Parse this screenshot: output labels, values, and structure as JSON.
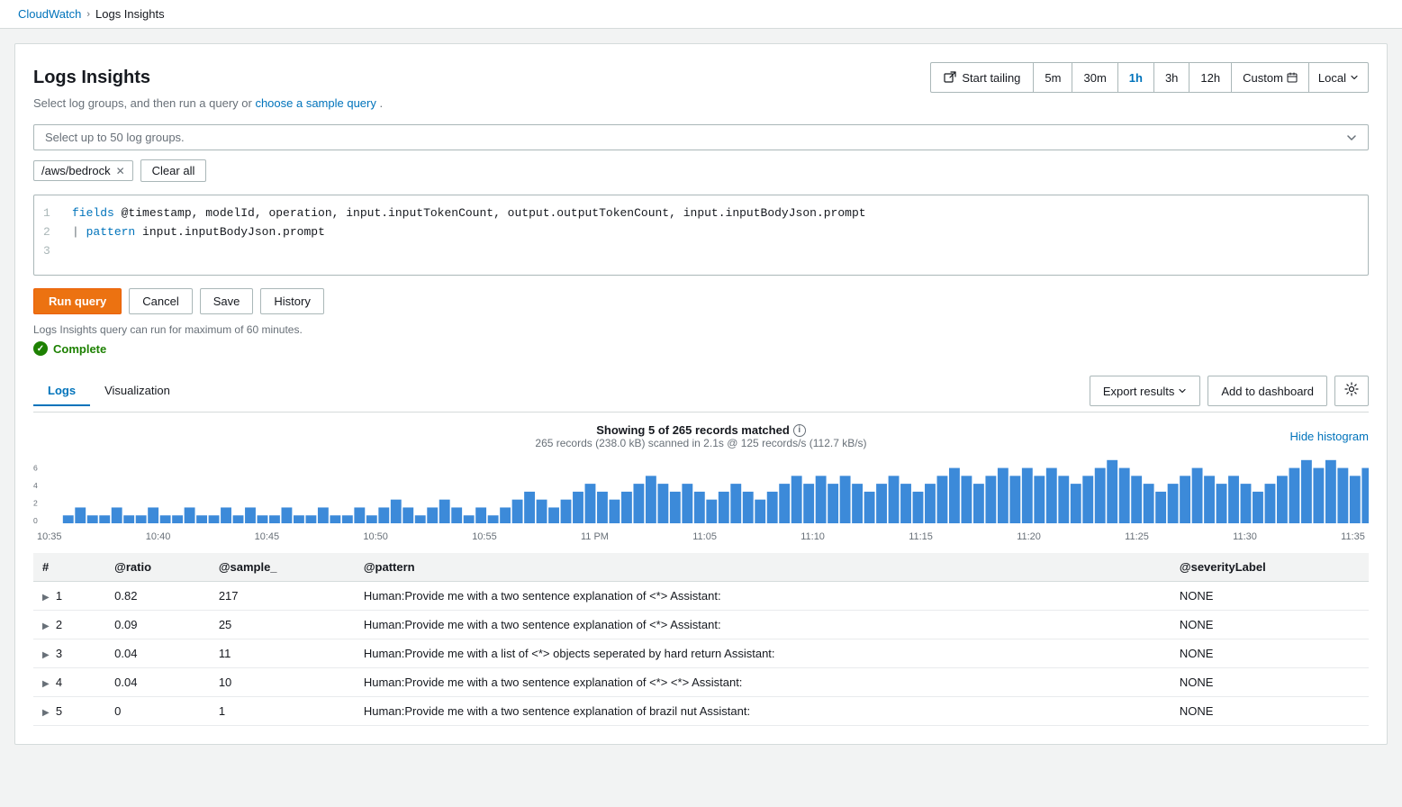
{
  "breadcrumb": {
    "parent": "CloudWatch",
    "separator": "›",
    "current": "Logs Insights"
  },
  "header": {
    "title": "Logs Insights",
    "subtitle_before": "Select log groups, and then run a query or",
    "subtitle_link": "choose a sample query",
    "subtitle_after": ".",
    "start_tailing_label": "Start tailing",
    "time_options": [
      "5m",
      "30m",
      "1h",
      "3h",
      "12h"
    ],
    "active_time": "1h",
    "custom_label": "Custom",
    "local_label": "Local"
  },
  "log_group_selector": {
    "placeholder": "Select up to 50 log groups.",
    "selected_tags": [
      {
        "name": "/aws/bedrock"
      }
    ],
    "clear_all_label": "Clear all"
  },
  "query_editor": {
    "lines": [
      {
        "num": "1",
        "content": "fields @timestamp, modelId, operation, input.inputTokenCount, output.outputTokenCount, input.inputBodyJson.prompt"
      },
      {
        "num": "2",
        "content": "| pattern input.inputBodyJson.prompt"
      },
      {
        "num": "3",
        "content": ""
      }
    ],
    "run_label": "Run query",
    "cancel_label": "Cancel",
    "save_label": "Save",
    "history_label": "History",
    "note": "Logs Insights query can run for maximum of 60 minutes.",
    "status": "Complete"
  },
  "tabs": [
    {
      "id": "logs",
      "label": "Logs",
      "active": true
    },
    {
      "id": "visualization",
      "label": "Visualization",
      "active": false
    }
  ],
  "results_controls": {
    "export_label": "Export results",
    "dashboard_label": "Add to dashboard"
  },
  "histogram": {
    "title": "Showing 5 of 265 records matched",
    "subtitle": "265 records (238.0 kB) scanned in 2.1s @ 125 records/s (112.7 kB/s)",
    "hide_label": "Hide histogram",
    "x_labels": [
      "10:35",
      "10:40",
      "10:45",
      "10:50",
      "10:55",
      "11 PM",
      "11:05",
      "11:10",
      "11:15",
      "11:20",
      "11:25",
      "11:30",
      "11:35"
    ],
    "bars": [
      0,
      1,
      2,
      1,
      1,
      2,
      1,
      1,
      2,
      1,
      1,
      2,
      1,
      1,
      2,
      1,
      2,
      1,
      1,
      2,
      1,
      1,
      2,
      1,
      1,
      2,
      1,
      2,
      3,
      2,
      1,
      2,
      3,
      2,
      1,
      2,
      1,
      2,
      3,
      4,
      3,
      2,
      3,
      4,
      5,
      4,
      3,
      4,
      5,
      6,
      5,
      4,
      5,
      4,
      3,
      4,
      5,
      4,
      3,
      4,
      5,
      6,
      5,
      6,
      5,
      6,
      5,
      4,
      5,
      6,
      5,
      4,
      5,
      6,
      7,
      6,
      5,
      6,
      7,
      6,
      7,
      6,
      7,
      6,
      5,
      6,
      7,
      8,
      7,
      6,
      5,
      4,
      5,
      6,
      7,
      6,
      5,
      6,
      5,
      4,
      5,
      6,
      7,
      8,
      7,
      8,
      7,
      6,
      7,
      8
    ]
  },
  "table": {
    "columns": [
      "#",
      "@ratio",
      "@sample_",
      "@pattern",
      "@severityLabel"
    ],
    "rows": [
      {
        "num": "1",
        "ratio": "0.82",
        "sample": "217",
        "pattern": "Human:Provide me with a two sentence explanation of <*> Assistant:",
        "severity": "NONE"
      },
      {
        "num": "2",
        "ratio": "0.09",
        "sample": "25",
        "pattern": "Human:Provide me with a two sentence explanation of <*> Assistant:",
        "severity": "NONE"
      },
      {
        "num": "3",
        "ratio": "0.04",
        "sample": "11",
        "pattern": "Human:Provide me with a list of <*> objects seperated by hard return Assistant:",
        "severity": "NONE"
      },
      {
        "num": "4",
        "ratio": "0.04",
        "sample": "10",
        "pattern": "Human:Provide me with a two sentence explanation of <*> <*> Assistant:",
        "severity": "NONE"
      },
      {
        "num": "5",
        "ratio": "0",
        "sample": "1",
        "pattern": "Human:Provide me with a two sentence explanation of brazil nut Assistant:",
        "severity": "NONE"
      }
    ]
  }
}
